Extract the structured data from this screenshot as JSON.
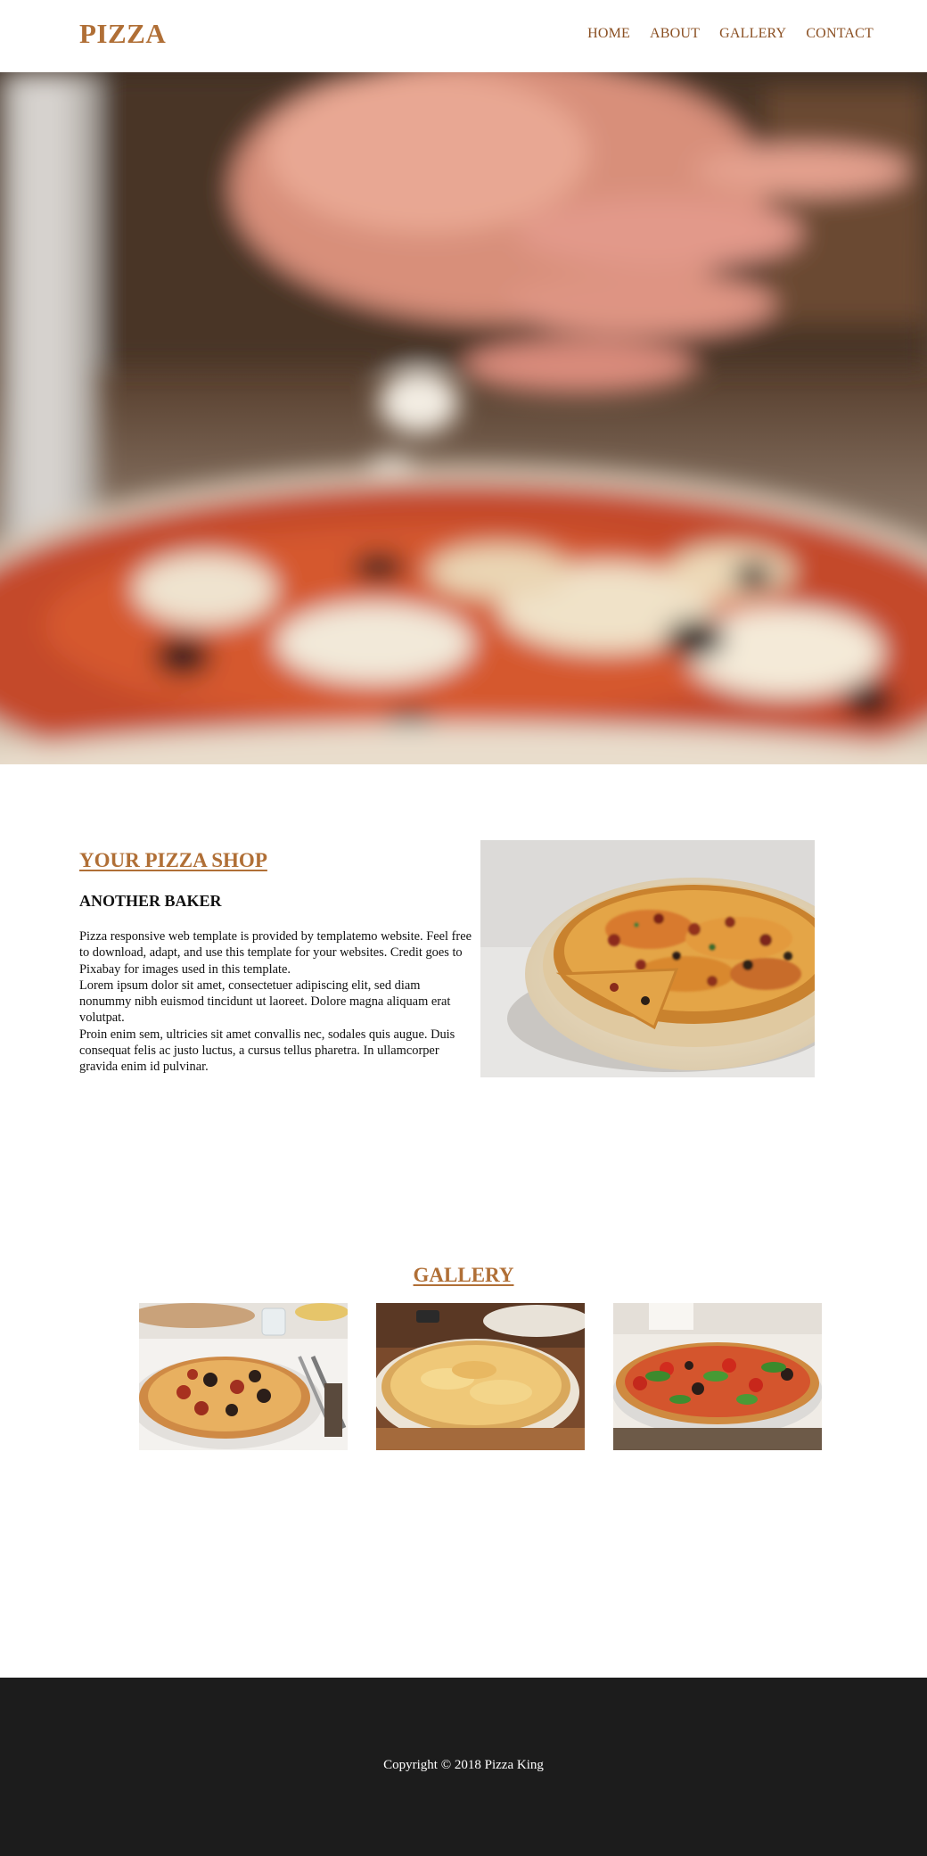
{
  "header": {
    "logo": "PIZZA",
    "nav": [
      "HOME",
      "ABOUT",
      "GALLERY",
      "CONTACT"
    ]
  },
  "about": {
    "title": "YOUR PIZZA SHOP",
    "subtitle": "ANOTHER BAKER",
    "paragraphs": [
      "Pizza responsive web template is provided by templatemo website. Feel free to download, adapt, and use this template for your websites. Credit goes to Pixabay for images used in this template.",
      "Lorem ipsum dolor sit amet, consectetuer adipiscing elit, sed diam nonummy nibh euismod tincidunt ut laoreet. Dolore magna aliquam erat volutpat.",
      "Proin enim sem, ultricies sit amet convallis nec, sodales quis augue. Duis consequat felis ac justo luctus, a cursus tellus pharetra. In ullamcorper gravida enim id pulvinar."
    ]
  },
  "gallery": {
    "title": "GALLERY"
  },
  "footer": {
    "copyright": "Copyright © 2018 Pizza King"
  },
  "colors": {
    "brand": "#b06f36",
    "nav": "#8a4f22",
    "footer_bg": "#1c1c1c"
  }
}
